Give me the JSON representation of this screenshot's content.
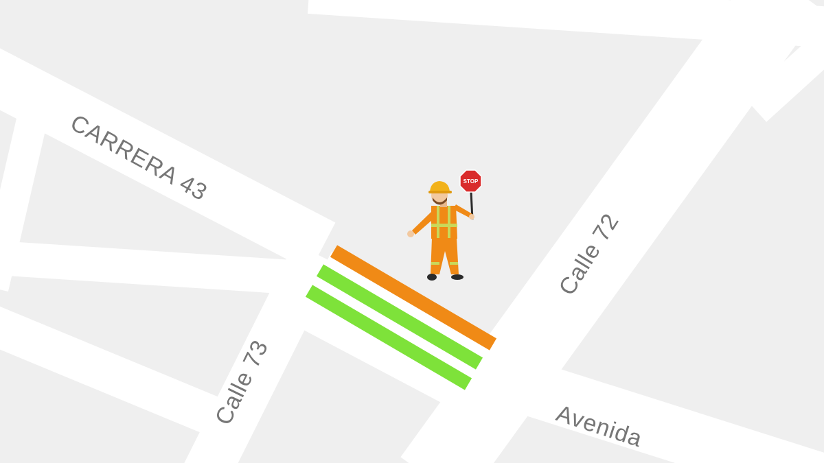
{
  "map": {
    "streets": [
      {
        "id": "carrera-43",
        "label": "CARRERA 43"
      },
      {
        "id": "calle-72",
        "label": "Calle 72"
      },
      {
        "id": "calle-73",
        "label": "Calle 73"
      },
      {
        "id": "avenida",
        "label": "Avenida"
      }
    ],
    "markers": {
      "traffic_worker": {
        "icon": "traffic-worker-with-stop-sign-icon",
        "sign_text": "STOP"
      },
      "crosswalk_stripes": [
        {
          "color": "#f08a16"
        },
        {
          "color": "#7ee23a"
        },
        {
          "color": "#7ee23a"
        }
      ]
    },
    "colors": {
      "background": "#efefef",
      "road": "#ffffff",
      "label": "#767676"
    }
  }
}
